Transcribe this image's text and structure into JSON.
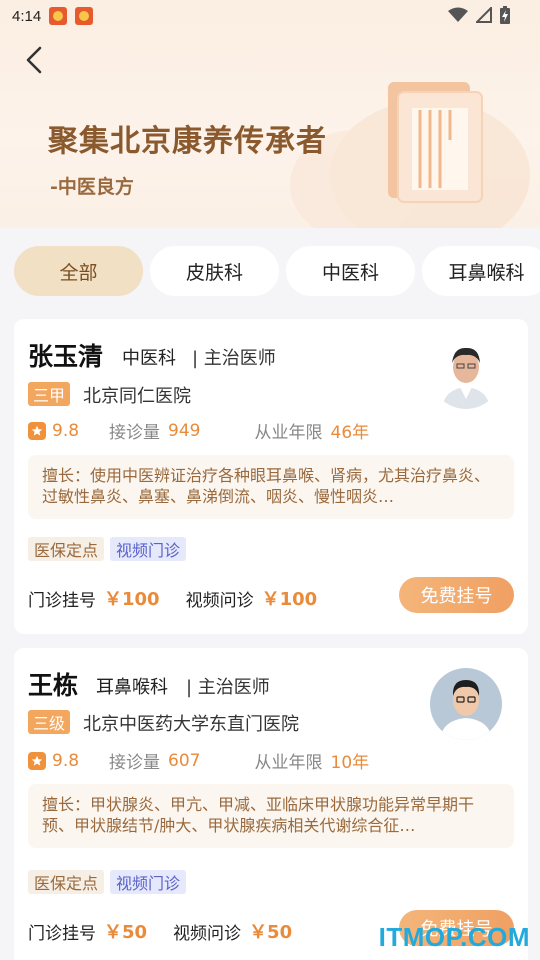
{
  "status_bar": {
    "time": "4:14"
  },
  "banner": {
    "slogan": "聚集北京康养传承者",
    "subtitle": "-中医良方"
  },
  "tabs": [
    {
      "label": "全部",
      "active": true
    },
    {
      "label": "皮肤科",
      "active": false
    },
    {
      "label": "中医科",
      "active": false
    },
    {
      "label": "耳鼻喉科",
      "active": false
    }
  ],
  "doctors": [
    {
      "name": "张玉清",
      "department": "中医科",
      "title": "| 主治医师",
      "level": "三甲",
      "hospital": "北京同仁医院",
      "rating": "9.8",
      "consult_label": "接诊量",
      "consult_count": "949",
      "years_label": "从业年限",
      "years": "46年",
      "specialty": "擅长：使用中医辨证治疗各种眼耳鼻喉、肾病，尤其治疗鼻炎、过敏性鼻炎、鼻塞、鼻涕倒流、咽炎、慢性咽炎…",
      "tags": [
        "医保定点",
        "视频门诊"
      ],
      "clinic_label": "门诊挂号",
      "clinic_price": "￥100",
      "video_label": "视频问诊",
      "video_price": "￥100",
      "button": "免费挂号"
    },
    {
      "name": "王栋",
      "department": "耳鼻喉科",
      "title": "| 主治医师",
      "level": "三级",
      "hospital": "北京中医药大学东直门医院",
      "rating": "9.8",
      "consult_label": "接诊量",
      "consult_count": "607",
      "years_label": "从业年限",
      "years": "10年",
      "specialty": "擅长：甲状腺炎、甲亢、甲减、亚临床甲状腺功能异常早期干预、甲状腺结节/肿大、甲状腺疾病相关代谢综合征…",
      "tags": [
        "医保定点",
        "视频门诊"
      ],
      "clinic_label": "门诊挂号",
      "clinic_price": "￥50",
      "video_label": "视频问诊",
      "video_price": "￥50",
      "button": "免费挂号"
    }
  ],
  "watermark": "ITMOP.COM",
  "colors": {
    "accent": "#f0a062",
    "active_tab": "#f1e0c4",
    "price": "#e98b3a",
    "video_tag": "#5a64c8"
  },
  "icons": [
    "back-arrow-icon",
    "star-icon",
    "wifi-icon",
    "signal-icon",
    "battery-icon"
  ]
}
